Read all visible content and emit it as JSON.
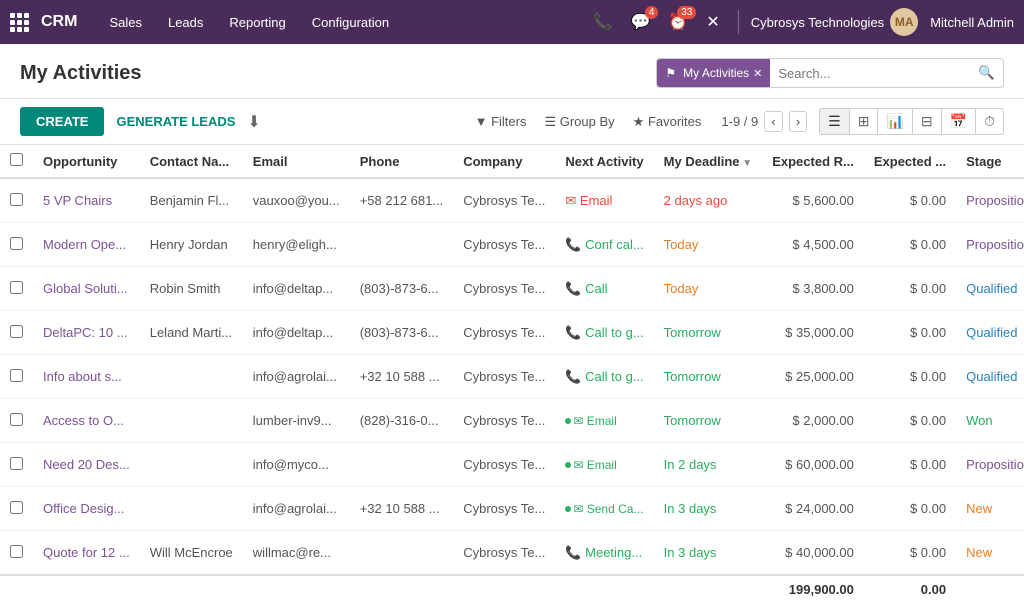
{
  "nav": {
    "app_name": "CRM",
    "links": [
      "Sales",
      "Leads",
      "Reporting",
      "Configuration"
    ],
    "icons": {
      "phone": "📞",
      "chat_count": "4",
      "activity_count": "33",
      "close": "✕"
    },
    "company": "Cybrosys Technologies",
    "user": "Mitchell Admin"
  },
  "page": {
    "title": "My Activities",
    "search_tag": "My Activities",
    "search_placeholder": "Search...",
    "create_label": "CREATE",
    "generate_leads_label": "GENERATE LEADS",
    "filters_label": "Filters",
    "group_by_label": "Group By",
    "favorites_label": "Favorites",
    "pagination": "1-9 / 9"
  },
  "table": {
    "columns": [
      "",
      "Opportunity",
      "Contact Na...",
      "Email",
      "Phone",
      "Company",
      "Next Activity",
      "My Deadline",
      "Expected R...",
      "Expected ...",
      "Stage",
      ""
    ],
    "rows": [
      {
        "opportunity": "5 VP Chairs",
        "contact": "Benjamin Fl...",
        "email": "vauxoo@you...",
        "phone": "+58 212 681...",
        "company": "Cybrosys Te...",
        "activity": "Email",
        "activity_type": "email",
        "deadline": "2 days ago",
        "deadline_class": "late",
        "expected_r": "$ 5,600.00",
        "expected2": "$ 0.00",
        "stage": "Proposition",
        "stage_class": "proposition"
      },
      {
        "opportunity": "Modern Ope...",
        "contact": "Henry Jordan",
        "email": "henry@eligh...",
        "phone": "",
        "company": "Cybrosys Te...",
        "activity": "Conf cal...",
        "activity_type": "call",
        "deadline": "Today",
        "deadline_class": "today",
        "expected_r": "$ 4,500.00",
        "expected2": "$ 0.00",
        "stage": "Proposition",
        "stage_class": "proposition"
      },
      {
        "opportunity": "Global Soluti...",
        "contact": "Robin Smith",
        "email": "info@deltap...",
        "phone": "(803)-873-6...",
        "company": "Cybrosys Te...",
        "activity": "Call",
        "activity_type": "call",
        "deadline": "Today",
        "deadline_class": "today",
        "expected_r": "$ 3,800.00",
        "expected2": "$ 0.00",
        "stage": "Qualified",
        "stage_class": "qualified"
      },
      {
        "opportunity": "DeltaPC: 10 ...",
        "contact": "Leland Marti...",
        "email": "info@deltap...",
        "phone": "(803)-873-6...",
        "company": "Cybrosys Te...",
        "activity": "Call to g...",
        "activity_type": "call",
        "deadline": "Tomorrow",
        "deadline_class": "future",
        "expected_r": "$ 35,000.00",
        "expected2": "$ 0.00",
        "stage": "Qualified",
        "stage_class": "qualified"
      },
      {
        "opportunity": "Info about s...",
        "contact": "",
        "email": "info@agrolai...",
        "phone": "+32 10 588 ...",
        "company": "Cybrosys Te...",
        "activity": "Call to g...",
        "activity_type": "call",
        "deadline": "Tomorrow",
        "deadline_class": "future",
        "expected_r": "$ 25,000.00",
        "expected2": "$ 0.00",
        "stage": "Qualified",
        "stage_class": "qualified"
      },
      {
        "opportunity": "Access to O...",
        "contact": "",
        "email": "lumber-inv9...",
        "phone": "(828)-316-0...",
        "company": "Cybrosys Te...",
        "activity": "Email",
        "activity_type": "email_green",
        "deadline": "Tomorrow",
        "deadline_class": "future",
        "expected_r": "$ 2,000.00",
        "expected2": "$ 0.00",
        "stage": "Won",
        "stage_class": "won"
      },
      {
        "opportunity": "Need 20 Des...",
        "contact": "",
        "email": "info@myco...",
        "phone": "",
        "company": "Cybrosys Te...",
        "activity": "Email",
        "activity_type": "email_green",
        "deadline": "In 2 days",
        "deadline_class": "future",
        "expected_r": "$ 60,000.00",
        "expected2": "$ 0.00",
        "stage": "Proposition",
        "stage_class": "proposition"
      },
      {
        "opportunity": "Office Desig...",
        "contact": "",
        "email": "info@agrolai...",
        "phone": "+32 10 588 ...",
        "company": "Cybrosys Te...",
        "activity": "Send Ca...",
        "activity_type": "email_green",
        "deadline": "In 3 days",
        "deadline_class": "future",
        "expected_r": "$ 24,000.00",
        "expected2": "$ 0.00",
        "stage": "New",
        "stage_class": "new"
      },
      {
        "opportunity": "Quote for 12 ...",
        "contact": "Will McEncroe",
        "email": "willmac@re...",
        "phone": "",
        "company": "Cybrosys Te...",
        "activity": "Meeting...",
        "activity_type": "call",
        "deadline": "In 3 days",
        "deadline_class": "future",
        "expected_r": "$ 40,000.00",
        "expected2": "$ 0.00",
        "stage": "New",
        "stage_class": "new"
      }
    ],
    "footer": {
      "expected_r_total": "199,900.00",
      "expected2_total": "0.00"
    }
  }
}
